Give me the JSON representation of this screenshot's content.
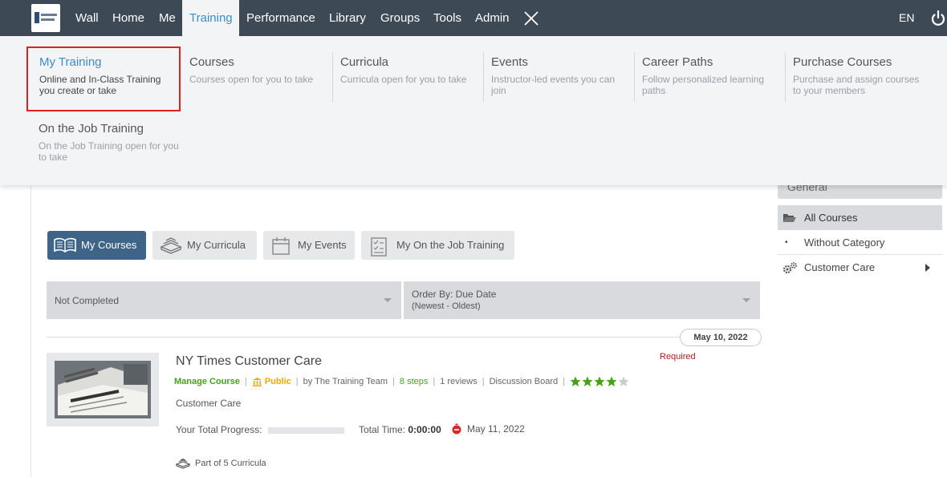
{
  "nav": {
    "items": [
      "Wall",
      "Home",
      "Me",
      "Training",
      "Performance",
      "Library",
      "Groups",
      "Tools",
      "Admin"
    ],
    "active": "Training",
    "language": "EN"
  },
  "mega_menu": {
    "items": [
      {
        "title": "My Training",
        "desc": "Online and In-Class Training you create or take"
      },
      {
        "title": "Courses",
        "desc": "Courses open for you to take"
      },
      {
        "title": "Curricula",
        "desc": "Curricula open for you to take"
      },
      {
        "title": "Events",
        "desc": "Instructor-led events you can join"
      },
      {
        "title": "Career Paths",
        "desc": "Follow personalized learning paths"
      },
      {
        "title": "Purchase Courses",
        "desc": "Purchase and assign courses to your members"
      },
      {
        "title": "On the Job Training",
        "desc": "On the Job Training open for you to take"
      }
    ]
  },
  "tabs": [
    {
      "label": "My Courses",
      "icon": "open-book-icon",
      "active": true
    },
    {
      "label": "My Curricula",
      "icon": "books-stack-icon",
      "active": false
    },
    {
      "label": "My Events",
      "icon": "calendar-icon",
      "active": false
    },
    {
      "label": "My On the Job Training",
      "icon": "checklist-icon",
      "active": false
    }
  ],
  "filters": {
    "status": "Not Completed",
    "order_by": "Order By: Due Date",
    "order_sub": "(Newest - Oldest)"
  },
  "date_group": "May 10, 2022",
  "course": {
    "required": "Required",
    "title": "NY Times Customer Care",
    "manage": "Manage Course",
    "visibility": "Public",
    "author": "by The Training Team",
    "steps": "8 steps",
    "reviews": "1 reviews",
    "board": "Discussion Board",
    "rating": 4,
    "rating_max": 5,
    "category": "Customer Care",
    "progress_label": "Your Total Progress:",
    "progress": 0,
    "time_label": "Total Time:",
    "time_value": "0:00:00",
    "due_date": "May 11, 2022",
    "curricula": "Part of 5 Curricula"
  },
  "sidebar": {
    "section": "General",
    "all_courses": "All Courses",
    "without_category": "Without Category",
    "customer_care": "Customer Care"
  },
  "colors": {
    "nav_bg": "#3d4a55",
    "accent_blue": "#3d8cc9",
    "tab_active": "#3e6588",
    "highlight_red": "#e02121",
    "green": "#46a11a",
    "orange": "#f0a800"
  }
}
